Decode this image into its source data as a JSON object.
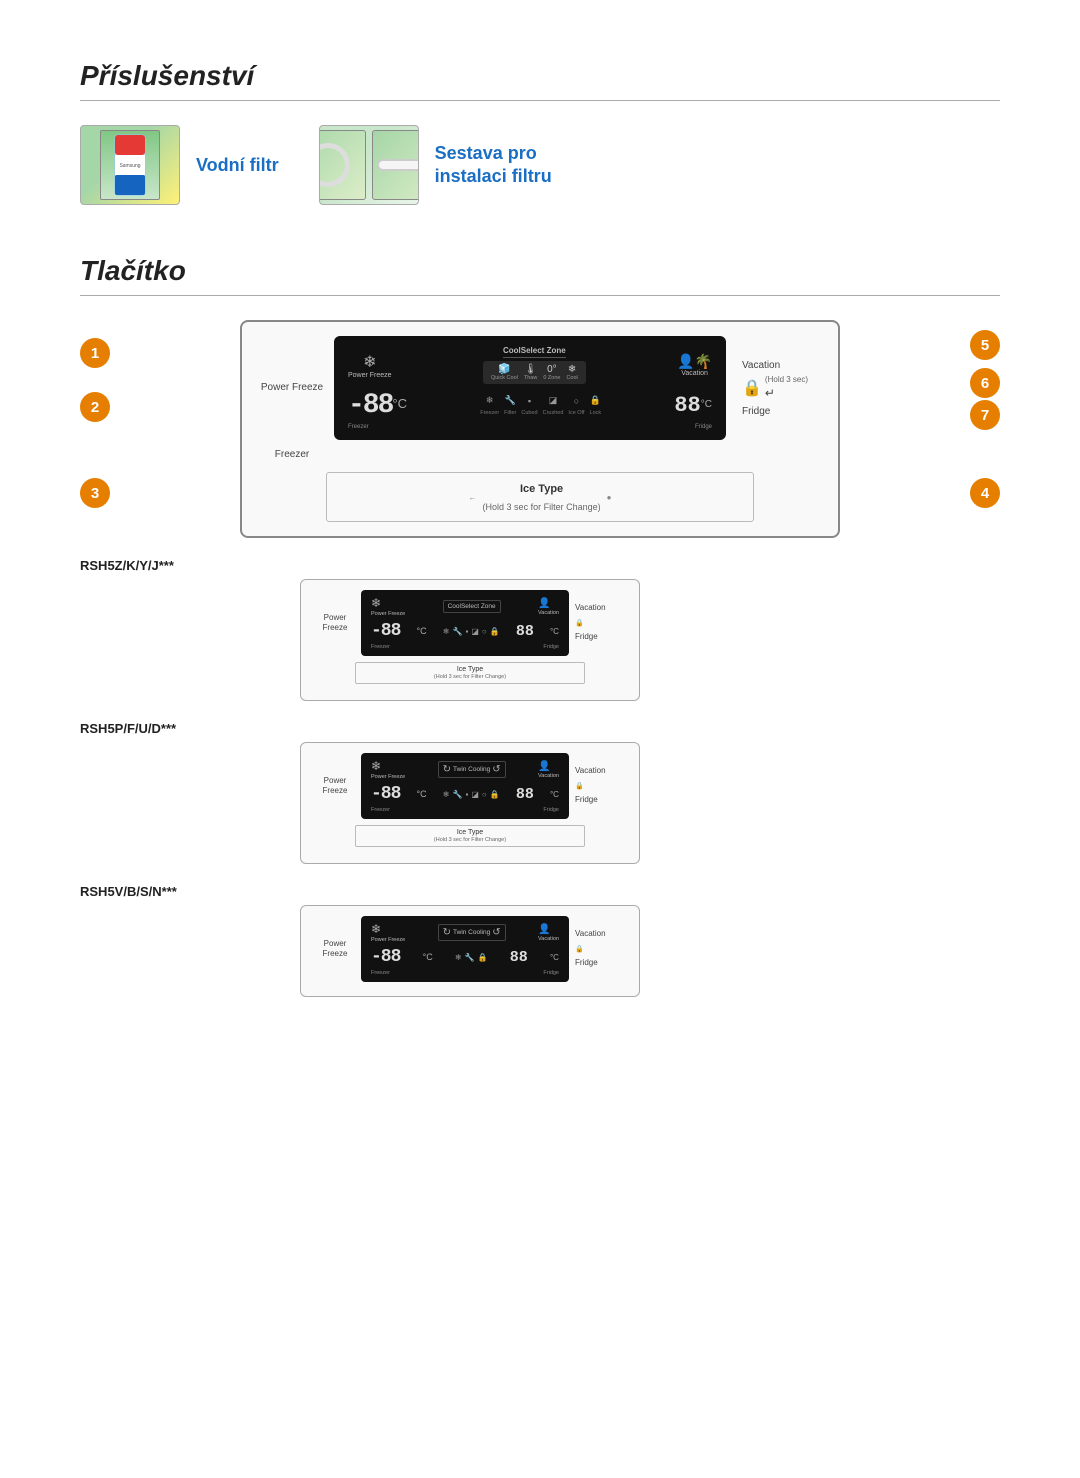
{
  "page": {
    "sections": {
      "accessories": {
        "title": "Příslušenství",
        "items": [
          {
            "name": "water-filter",
            "label": "Vodní filtr"
          },
          {
            "name": "filter-kit",
            "label": "Sestava pro instalaci filtru"
          }
        ]
      },
      "button": {
        "title": "Tlačítko",
        "badges": [
          "❶",
          "❷",
          "❸",
          "❹",
          "❺",
          "❻",
          "❼"
        ],
        "badge_numbers": [
          "1",
          "2",
          "3",
          "4",
          "5",
          "6",
          "7"
        ],
        "main_panel": {
          "left_labels": [
            {
              "text": "Power Freeze"
            },
            {
              "text": "Freezer"
            }
          ],
          "right_labels": [
            {
              "text": "Vacation"
            },
            {
              "text": "(Hold 3 sec)"
            },
            {
              "text": "Fridge"
            }
          ],
          "display": {
            "power_freeze": "Power Freeze",
            "coolselect_label": "CoolSelect Zone",
            "coolselect_icons": [
              "Quick Cool",
              "Thaw",
              "0 Zone",
              "Cool"
            ],
            "vacation": "Vacation",
            "freezer_temp": "-88",
            "temp_unit": "°C",
            "icons": [
              "Freezer",
              "Filter",
              "Cubed",
              "Crushed",
              "Ice Off",
              "Lock",
              "Fridge"
            ],
            "fridge_temp": "88",
            "fridge_unit": "°C"
          },
          "ice_type": {
            "label": "Ice Type",
            "sublabel": "(Hold 3 sec for Filter Change)"
          }
        },
        "models": [
          {
            "name": "RSH5Z/K/Y/J***",
            "type": "coolselect",
            "display": {
              "power_freeze": "Power Freeze",
              "coolselect_label": "CoolSelect Zone",
              "vacation": "Vacation",
              "freezer_temp": "-88",
              "fridge_temp": "88",
              "ice_type": "Ice Type",
              "ice_sublabel": "(Hold 3 sec for Filter Change)"
            }
          },
          {
            "name": "RSH5P/F/U/D***",
            "type": "twin",
            "display": {
              "power_freeze": "Power Freeze",
              "twin_cooling": "Twin Cooling",
              "vacation": "Vacation",
              "freezer_temp": "-88",
              "fridge_temp": "88",
              "ice_type": "Ice Type",
              "ice_sublabel": "(Hold 3 sec for Filter Change)"
            }
          },
          {
            "name": "RSH5V/B/S/N***",
            "type": "twin2",
            "display": {
              "power_freeze": "Power Freeze",
              "twin_cooling": "Twin Cooling",
              "vacation": "Vacation",
              "freezer_temp": "-88",
              "fridge_temp": "88"
            }
          }
        ]
      }
    }
  }
}
